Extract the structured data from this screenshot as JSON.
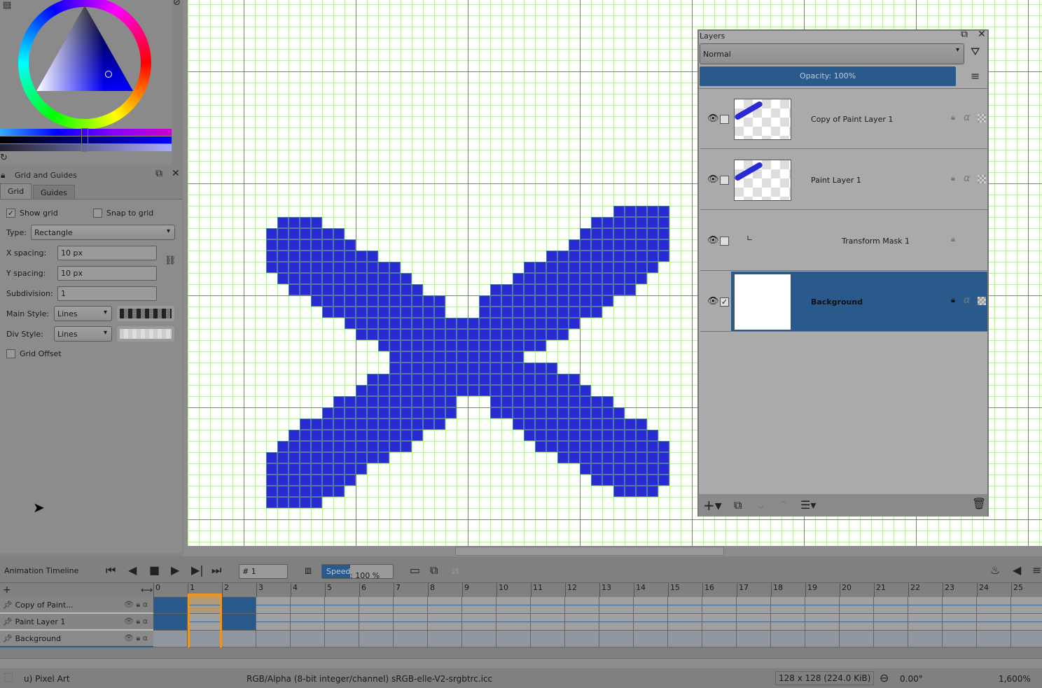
{
  "grid_panel": {
    "title": "Grid and Guides",
    "tabs": [
      "Grid",
      "Guides"
    ],
    "show_grid": "Show grid",
    "snap_to_grid": "Snap to grid",
    "type_label": "Type:",
    "type_value": "Rectangle",
    "x_spacing_label": "X spacing:",
    "x_spacing": "10 px",
    "y_spacing_label": "Y spacing:",
    "y_spacing": "10 px",
    "subdivision_label": "Subdivision:",
    "subdivision": "1",
    "main_style_label": "Main Style:",
    "main_style": "Lines",
    "div_style_label": "Div Style:",
    "div_style": "Lines",
    "grid_offset": "Grid Offset"
  },
  "layers": {
    "title": "Layers",
    "blend_mode": "Normal",
    "opacity": "Opacity:  100%",
    "items": [
      {
        "name": "Copy of Paint Layer 1"
      },
      {
        "name": "Paint Layer 1"
      },
      {
        "name": "Transform Mask 1"
      },
      {
        "name": "Background"
      }
    ]
  },
  "timeline": {
    "title": "Animation Timeline",
    "frame": "# 1",
    "speed_label": "Speed",
    "speed": ": 100 %",
    "frames": [
      "0",
      "1",
      "2",
      "3",
      "4",
      "5",
      "6",
      "7",
      "8",
      "9",
      "10",
      "11",
      "12",
      "13",
      "14",
      "15",
      "16",
      "17",
      "18",
      "19",
      "20",
      "21",
      "22",
      "23",
      "24",
      "25"
    ],
    "rows": [
      "Copy of Paint...",
      "Paint Layer 1",
      "Background"
    ]
  },
  "status": {
    "tool": "u) Pixel Art",
    "color_space": "RGB/Alpha (8-bit integer/channel)  sRGB-elle-V2-srgbtrc.icc",
    "size": "128 x 128 (224.0 KiB)",
    "rotation": "0.00°",
    "zoom": "1,600%"
  },
  "colors": {
    "accent": "#2a5a8c",
    "paint": "#2a2ad4",
    "frame_highlight": "#e8962a"
  }
}
